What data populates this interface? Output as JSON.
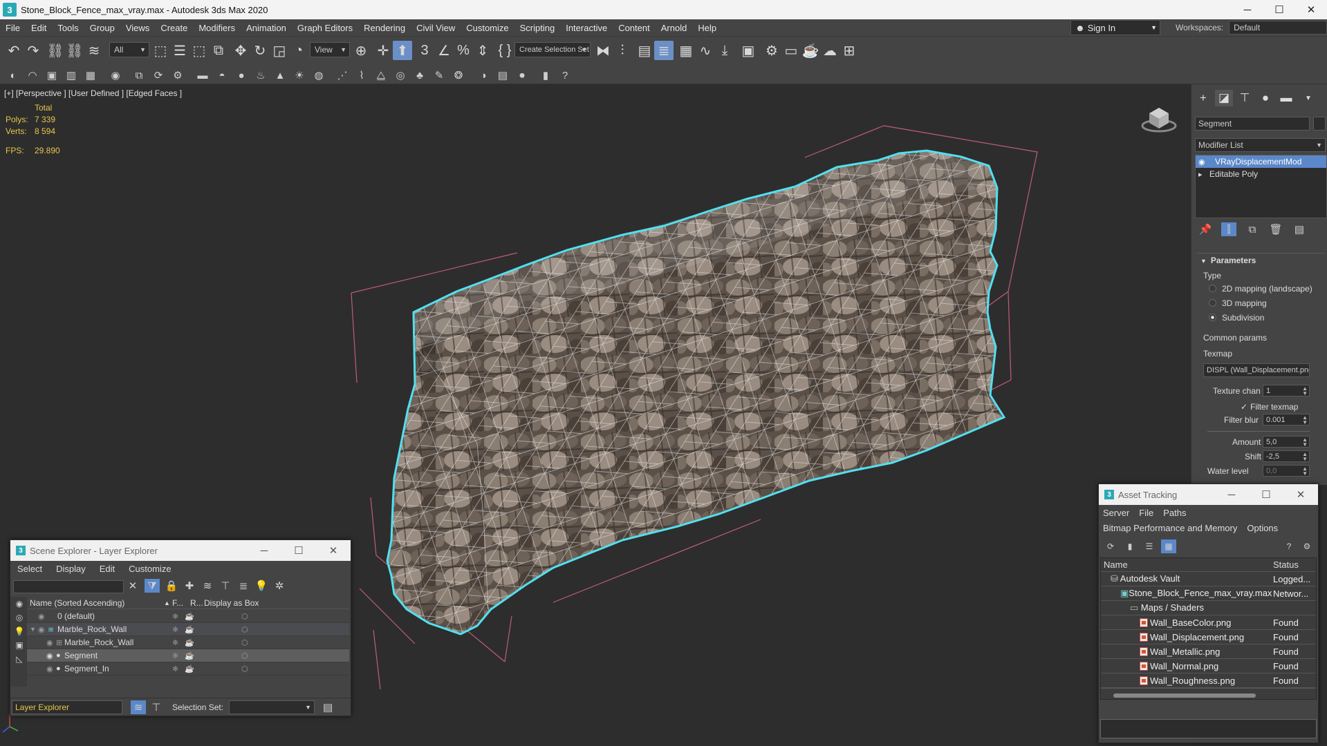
{
  "window": {
    "title": "Stone_Block_Fence_max_vray.max - Autodesk 3ds Max 2020",
    "app_icon": "3",
    "minimize": "─",
    "maximize": "☐",
    "close": "✕"
  },
  "menu": [
    "File",
    "Edit",
    "Tools",
    "Group",
    "Views",
    "Create",
    "Modifiers",
    "Animation",
    "Graph Editors",
    "Rendering",
    "Civil View",
    "Customize",
    "Scripting",
    "Interactive",
    "Content",
    "Arnold",
    "Help"
  ],
  "signin": {
    "label": "Sign In"
  },
  "workspace": {
    "label": "Workspaces:",
    "value": "Default"
  },
  "toolbar": {
    "filter": "All",
    "ref_coord": "View",
    "selection_set": "Create Selection Set",
    "snap_label": "3"
  },
  "viewport": {
    "label": "[+] [Perspective ] [User Defined ] [Edged Faces ]",
    "stats": {
      "total": "Total",
      "polys_label": "Polys:",
      "polys": "7 339",
      "verts_label": "Verts:",
      "verts": "8 594",
      "fps_label": "FPS:",
      "fps": "29.890"
    }
  },
  "command_panel": {
    "object_name": "Segment",
    "modifier_list": "Modifier List",
    "stack": [
      {
        "label": "VRayDisplacementMod",
        "selected": true
      },
      {
        "label": "Editable Poly",
        "selected": false
      }
    ],
    "rollout": "Parameters",
    "type_label": "Type",
    "types": [
      {
        "label": "2D mapping (landscape)",
        "on": false
      },
      {
        "label": "3D mapping",
        "on": false
      },
      {
        "label": "Subdivision",
        "on": true
      }
    ],
    "common_params": "Common params",
    "texmap_label": "Texmap",
    "texmap_value": "DISPL (Wall_Displacement.png)",
    "texture_chan_label": "Texture chan",
    "texture_chan": "1",
    "filter_texmap": "Filter texmap",
    "filter_blur_label": "Filter blur",
    "filter_blur": "0.001",
    "amount_label": "Amount",
    "amount": "5,0",
    "shift_label": "Shift",
    "shift": "-2,5",
    "water_level_label": "Water level",
    "water_level": "0,0"
  },
  "scene_explorer": {
    "title": "Scene Explorer - Layer Explorer",
    "menu": [
      "Select",
      "Display",
      "Edit",
      "Customize"
    ],
    "columns": {
      "name": "Name (Sorted Ascending)",
      "frozen": "F...",
      "render": "R...",
      "box": "Display as Box"
    },
    "rows": [
      {
        "name": "0 (default)",
        "selected": false
      },
      {
        "name": "Marble_Rock_Wall",
        "selected": false
      },
      {
        "name": "Marble_Rock_Wall",
        "selected": false
      },
      {
        "name": "Segment",
        "selected": true
      },
      {
        "name": "Segment_In",
        "selected": false
      }
    ],
    "footer_explorer": "Layer Explorer",
    "selection_set_label": "Selection Set:"
  },
  "asset_tracking": {
    "title": "Asset Tracking",
    "menu": [
      "Server",
      "File",
      "Paths"
    ],
    "menu2": [
      "Bitmap Performance and Memory",
      "Options"
    ],
    "columns": {
      "name": "Name",
      "status": "Status"
    },
    "rows": [
      {
        "name": "Autodesk Vault",
        "status": "Logged..."
      },
      {
        "name": "Stone_Block_Fence_max_vray.max",
        "status": "Networ..."
      },
      {
        "name": "Maps / Shaders",
        "status": ""
      },
      {
        "name": "Wall_BaseColor.png",
        "status": "Found"
      },
      {
        "name": "Wall_Displacement.png",
        "status": "Found"
      },
      {
        "name": "Wall_Metallic.png",
        "status": "Found"
      },
      {
        "name": "Wall_Normal.png",
        "status": "Found"
      },
      {
        "name": "Wall_Roughness.png",
        "status": "Found"
      }
    ]
  },
  "colors": {
    "selection_outline": "#52e0f0",
    "bbox": "#c25b7a",
    "stats": "#e6c84a",
    "highlight": "#5b88c9"
  }
}
